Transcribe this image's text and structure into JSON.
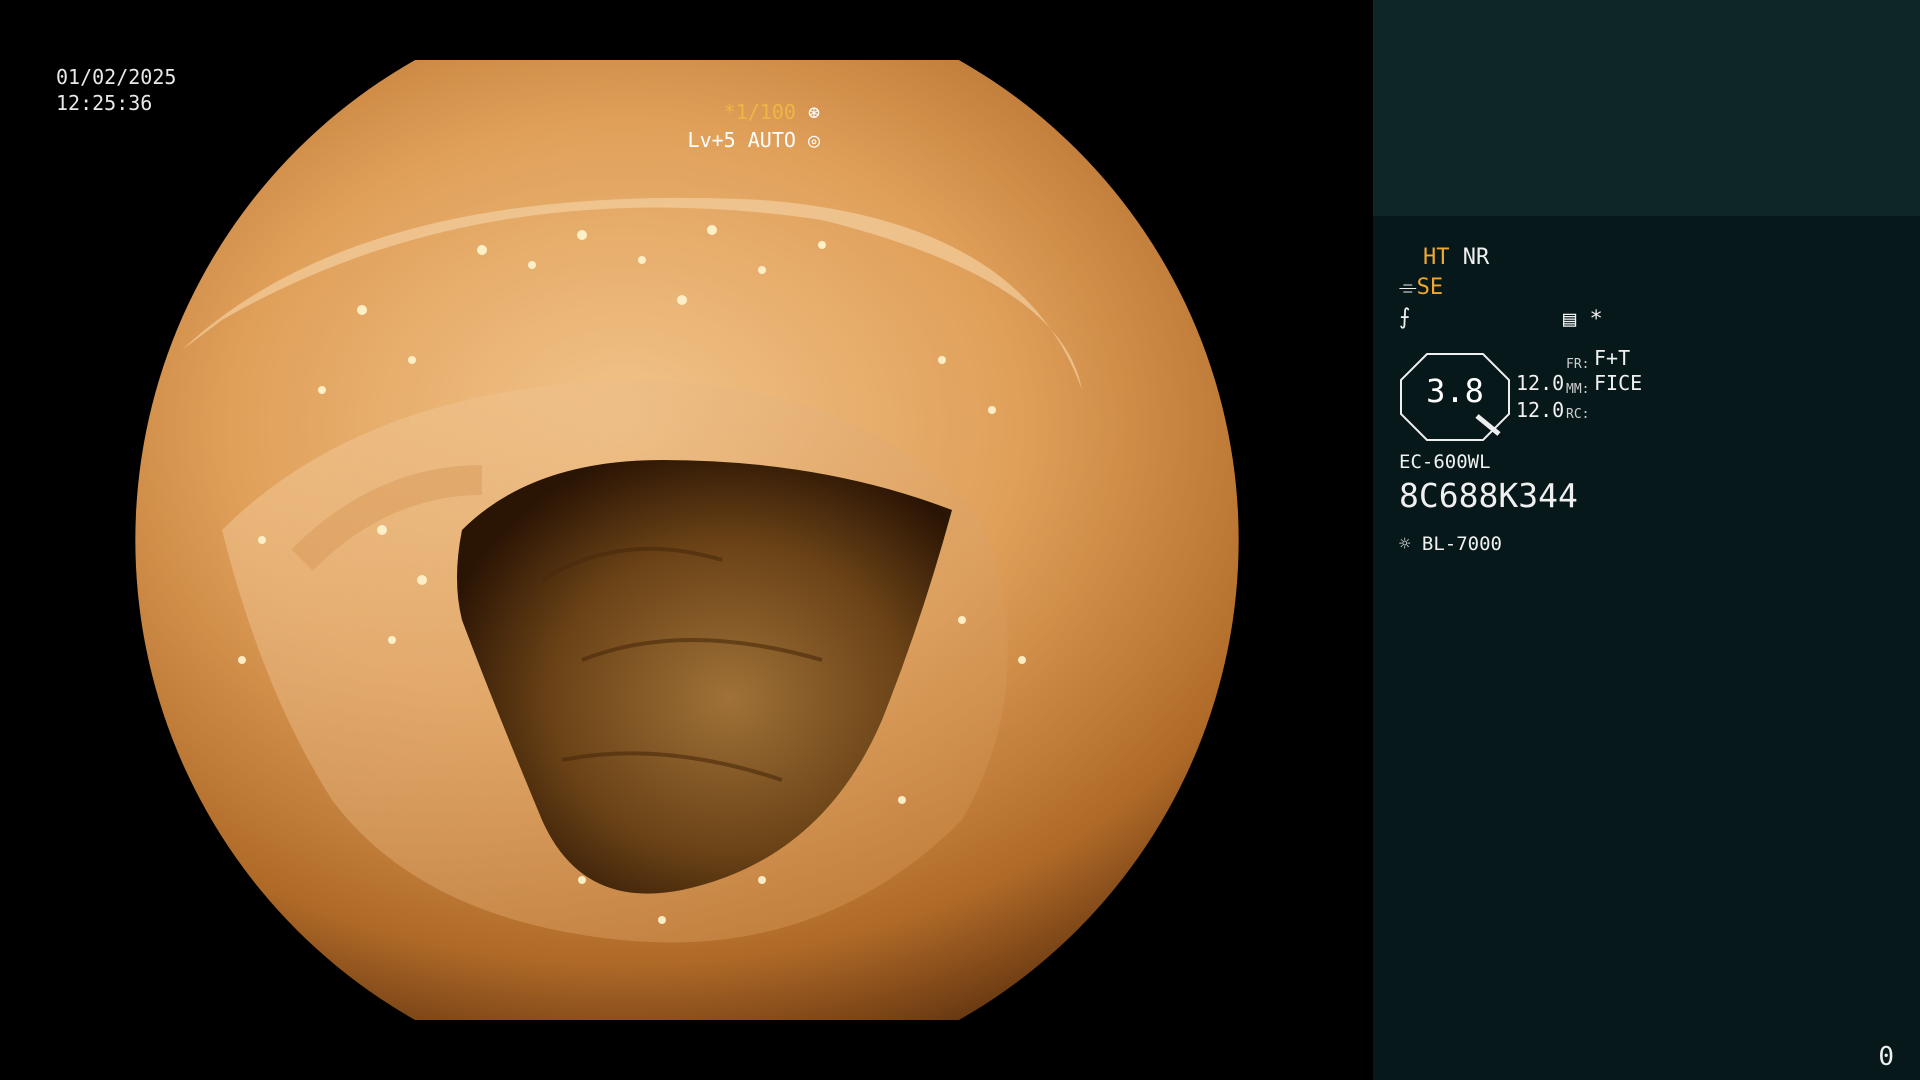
{
  "timestamp": {
    "date": "01/02/2025",
    "time": "12:25:36"
  },
  "top_right": {
    "shutter": "*1/100",
    "level": "Lv+5 AUTO",
    "shutter_icon": "aperture-icon",
    "auto_icon": "target-icon"
  },
  "panel": {
    "ht": "HT",
    "nr": "NR",
    "se": "SE",
    "zoom_value": "3.8",
    "vals": [
      "12.0",
      "12.0"
    ],
    "labels": [
      "FR:",
      "MM:",
      "RC:"
    ],
    "modes": [
      "F+T",
      "FICE"
    ],
    "scope_model": "EC-600WL",
    "serial": "8C688K344",
    "light_source": "BL-7000",
    "star": "*"
  },
  "corner_value": "0",
  "colors": {
    "panel": "#06181a",
    "panel_top": "#0e2625",
    "accent_orange": "#f0a830"
  }
}
